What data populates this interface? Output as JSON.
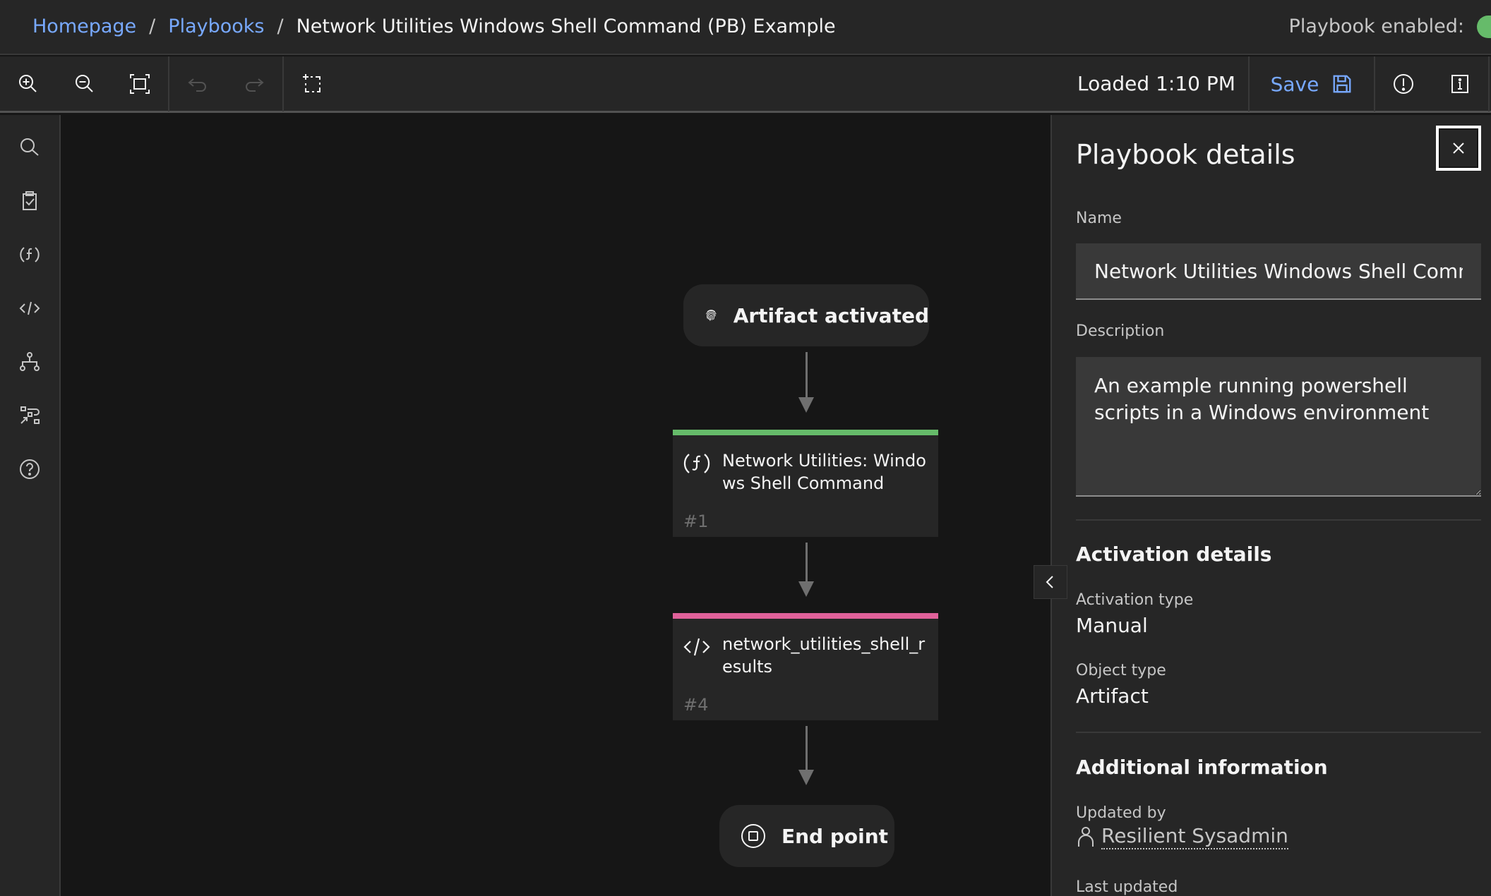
{
  "header": {
    "breadcrumb": [
      {
        "label": "Homepage",
        "link": true
      },
      {
        "label": "Playbooks",
        "link": true
      },
      {
        "label": "Network Utilities Windows Shell Command (PB) Example",
        "link": false
      }
    ],
    "separator": "/",
    "enabled_label": "Playbook enabled:",
    "enabled": true
  },
  "toolbar": {
    "buttons": [
      {
        "icon": "zoom-in-icon",
        "enabled": true
      },
      {
        "icon": "zoom-out-icon",
        "enabled": true
      },
      {
        "icon": "fit-to-screen-icon",
        "enabled": true
      },
      {
        "icon": "undo-icon",
        "enabled": false
      },
      {
        "icon": "redo-icon",
        "enabled": false
      },
      {
        "icon": "select-region-icon",
        "enabled": true
      }
    ],
    "loaded_status": "Loaded 1:10 PM",
    "save_label": "Save",
    "save_icon": "save-icon",
    "warnings_icon": "warning-icon",
    "info_icon": "info-icon"
  },
  "sidebar": {
    "items": [
      {
        "icon": "search-icon"
      },
      {
        "icon": "task-clipboard-icon"
      },
      {
        "icon": "function-icon"
      },
      {
        "icon": "script-code-icon"
      },
      {
        "icon": "decision-tree-icon"
      },
      {
        "icon": "subplaybook-flow-icon"
      },
      {
        "icon": "help-icon"
      }
    ]
  },
  "canvas": {
    "start": {
      "label": "Artifact activated",
      "icon": "fingerprint-icon"
    },
    "nodes": [
      {
        "title": "Network Utilities: Windows Shell Command",
        "number": "#1",
        "type": "function",
        "icon": "function-icon",
        "color": "#66bb6a"
      },
      {
        "title": "network_utilities_shell_results",
        "number": "#4",
        "type": "script",
        "icon": "script-code-icon",
        "color": "#e0619a"
      }
    ],
    "end": {
      "label": "End point",
      "icon": "stop-circle-icon"
    }
  },
  "panel": {
    "title": "Playbook details",
    "name_label": "Name",
    "name_value": "Network Utilities Windows Shell Command (PB) Example",
    "description_label": "Description",
    "description_value": "An example running powershell scripts in a Windows environment",
    "activation_section": "Activation details",
    "activation_type_label": "Activation type",
    "activation_type_value": "Manual",
    "object_type_label": "Object type",
    "object_type_value": "Artifact",
    "additional_section": "Additional information",
    "updated_by_label": "Updated by",
    "updated_by_value": "Resilient Sysadmin",
    "last_updated_label": "Last updated"
  },
  "colors": {
    "accent": "#78a9ff",
    "enabled_green": "#66bb6a",
    "function_bar": "#66bb6a",
    "script_bar": "#e0619a"
  }
}
